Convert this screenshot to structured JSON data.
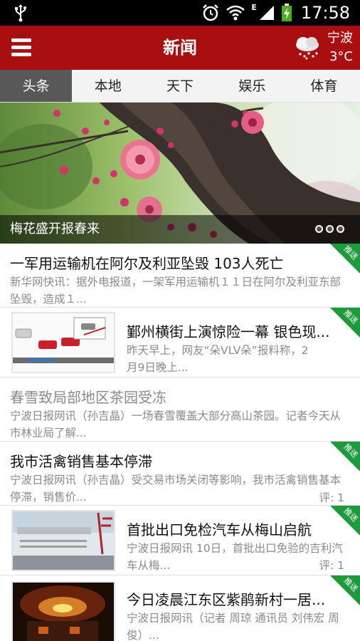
{
  "status_bar": {
    "time": "17:58",
    "network": "E",
    "icons": [
      "usb-icon",
      "alarm-clock-icon",
      "wifi-icon",
      "signal-icon",
      "battery-icon"
    ]
  },
  "header": {
    "title": "新闻",
    "weather": {
      "city": "宁波",
      "temperature": "3°C",
      "icon": "cloud-snow-icon"
    },
    "accent_color": "#a80f10"
  },
  "tabs": [
    {
      "label": "头条",
      "active": true
    },
    {
      "label": "本地",
      "active": false
    },
    {
      "label": "天下",
      "active": false
    },
    {
      "label": "娱乐",
      "active": false
    },
    {
      "label": "体育",
      "active": false
    }
  ],
  "banner": {
    "caption": "梅花盛开报春来",
    "image": "plum-blossom-photo"
  },
  "badge_label": "推送",
  "badge_color": "#1d9a3c",
  "news": [
    {
      "title": "一军用运输机在阿尔及利亚坠毁 103人死亡",
      "summary": "新华网快讯：据外电报道，一架军用运输机１１日在阿尔及利亚东部坠毁，造成１...",
      "pushed": true,
      "read": false,
      "thumbnail": null,
      "comments": null
    },
    {
      "title": "鄞州横街上演惊险一幕 银色现...",
      "summary": "昨天早上，网友“朵VLV朵”报料称，2月9日晚上...",
      "pushed": true,
      "read": false,
      "thumbnail": "traffic-diagram",
      "comments": null
    },
    {
      "title": "春雪致局部地区茶园受冻",
      "summary": "宁波日报网讯（孙吉晶）一场春雪覆盖大部分高山茶园。记者今天从市林业局了解...",
      "pushed": false,
      "read": true,
      "thumbnail": null,
      "comments": null
    },
    {
      "title": "我市活禽销售基本停滞",
      "summary": "宁波日报网讯（孙吉晶）受交易市场关闭等影响，我市活禽销售基本停滞，销售价...",
      "pushed": true,
      "read": false,
      "thumbnail": null,
      "comments": "评: 1"
    },
    {
      "title": "首批出口免检汽车从梅山启航",
      "summary": "宁波日报网讯 10日，首批出口免验的吉利汽车从梅...",
      "pushed": true,
      "read": false,
      "thumbnail": "car-carrier-ship",
      "comments": "评: 1"
    },
    {
      "title": "今日凌晨江东区紫鹃新村一居...",
      "summary": "宁波日报网讯（记者 周琼 通讯员 刘伟宏 周俊）...",
      "pushed": true,
      "read": false,
      "thumbnail": "fire-night-scene",
      "comments": null
    }
  ]
}
